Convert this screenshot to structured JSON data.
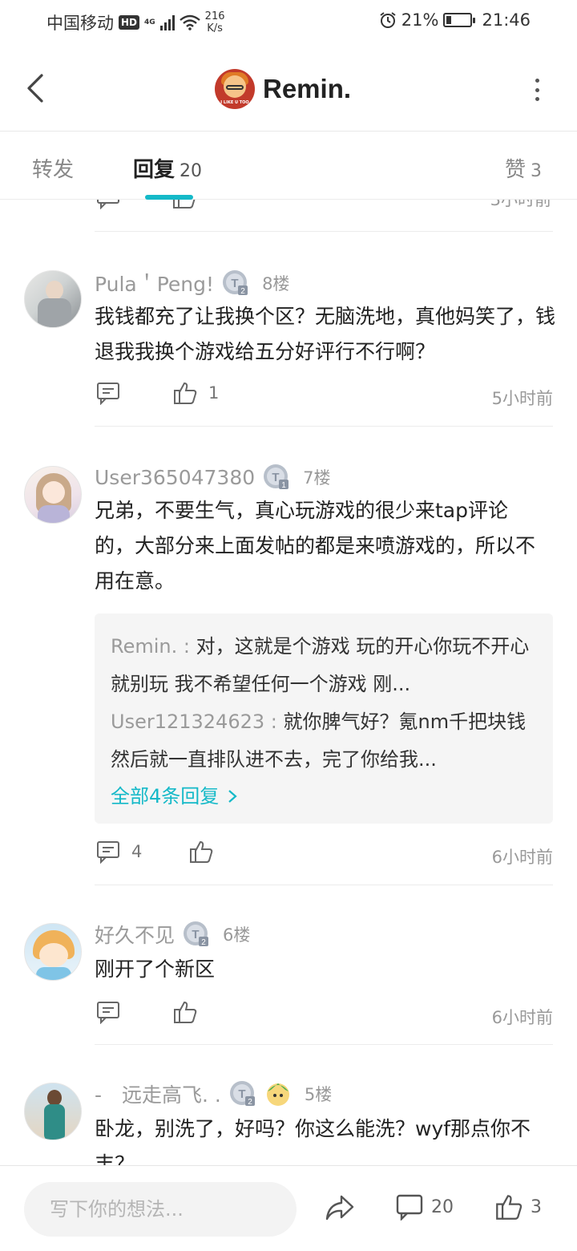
{
  "status_bar": {
    "carrier": "中国移动",
    "hd": "HD",
    "network": "4G",
    "speed": "216",
    "speed_unit": "K/s",
    "battery_percent": "21%",
    "battery_level": 0.21,
    "time": "21:46"
  },
  "header": {
    "title": "Remin.",
    "logo_text": "I LIKE U TOO"
  },
  "tabs": [
    {
      "label": "转发",
      "count": ""
    },
    {
      "label": "回复",
      "count": "20"
    },
    {
      "label": "赞",
      "count": "3"
    }
  ],
  "partial_row": {
    "time": "3小时前"
  },
  "comments": [
    {
      "user": "Pula＇Peng!",
      "badge": "T2",
      "floor": "8楼",
      "text": "我钱都充了让我换个区？无脑洗地，真他妈笑了，钱退我我换个游戏给五分好评行不行啊？",
      "reply_count": "",
      "like_count": "1",
      "time": "5小时前"
    },
    {
      "user": "User365047380",
      "badge": "T1",
      "floor": "7楼",
      "text": "兄弟，不要生气，真心玩游戏的很少来tap评论的，大部分来上面发帖的都是来喷游戏的，所以不用在意。",
      "replies": [
        {
          "author": "Remin. : ",
          "text": "对，这就是个游戏 玩的开心你玩不开心就别玩 我不希望任何一个游戏 刚..."
        },
        {
          "author": "User121324623 : ",
          "text": "就你脾气好？氪nm千把块钱然后就一直排队进不去，完了你给我..."
        }
      ],
      "reply_more": "全部4条回复",
      "reply_count": "4",
      "like_count": "",
      "time": "6小时前"
    },
    {
      "user": "好久不见",
      "badge": "T2",
      "floor": "6楼",
      "text": "刚开了个新区",
      "reply_count": "",
      "like_count": "",
      "time": "6小时前"
    },
    {
      "user": "-　远走高飞. .",
      "badge": "T2",
      "floor": "5楼",
      "text": "卧龙，别洗了，好吗？你这么能洗？wyf那点你不丰？"
    }
  ],
  "bottom_bar": {
    "placeholder": "写下你的想法...",
    "comment_count": "20",
    "like_count": "3"
  },
  "colors": {
    "accent": "#14b9c8",
    "logo_bg": "#c23a2b"
  },
  "icons": [
    "back-arrow-icon",
    "more-vertical-icon",
    "comment-icon",
    "thumbs-up-icon",
    "share-icon",
    "level-badge-icon"
  ]
}
